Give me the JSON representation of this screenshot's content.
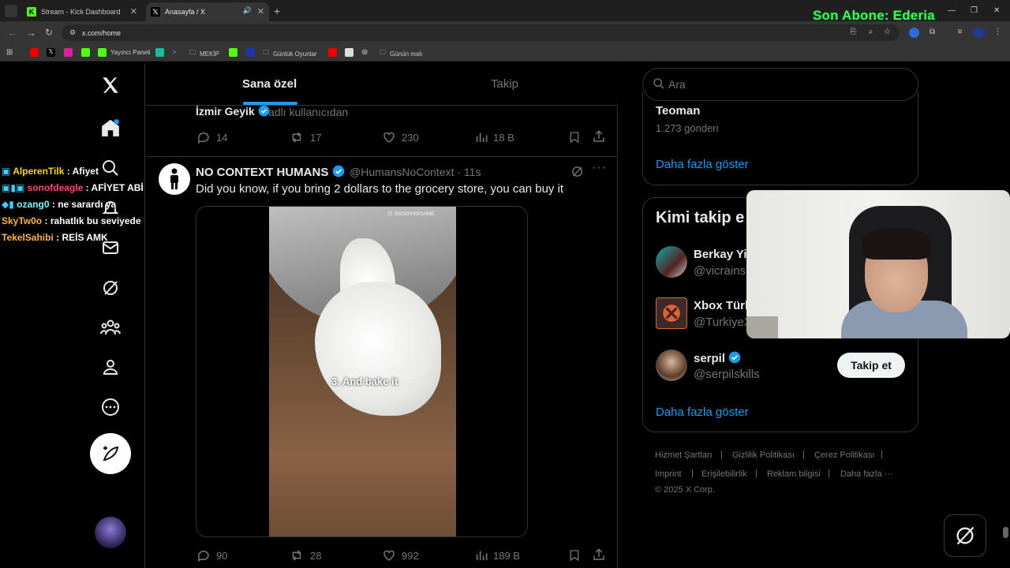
{
  "browser": {
    "tabs": [
      {
        "title": "Stream - Kick Dashboard",
        "favicon": "kick-icon"
      },
      {
        "title": "Anasayfa / X",
        "favicon": "x-icon"
      }
    ],
    "overlay_subscriber": "Son Abone: Ederia",
    "url": "x.com/home",
    "bookmarks": [
      "Yayıncı Paneli",
      "MEKİP",
      "Günlük Oyunlar",
      "Günün malı"
    ]
  },
  "chat": [
    {
      "user": "AlperenTilk",
      "message": "Afiyet",
      "color": "#ffd700"
    },
    {
      "user": "sonofdeagle",
      "message": "AFİYET ABİ",
      "color": "#ff4d6d"
    },
    {
      "user": "ozang0",
      "message": "ne sarardı ya",
      "color": "#7cf7ff"
    },
    {
      "user": "SkyTw0o",
      "message": "rahatlık bu seviyede",
      "color": "#ffb347"
    },
    {
      "user": "TekelSahibi",
      "message": "REİS AMK",
      "color": "#ffb347"
    }
  ],
  "feed": {
    "tabs": [
      "Sana özel",
      "Takip"
    ],
    "active_tab": "Sana özel",
    "previous_post": {
      "user": "İzmir Geyik",
      "suffix": "adlı kullanıcıdan",
      "replies": "14",
      "reposts": "17",
      "likes": "230",
      "views": "18 B"
    },
    "tweet": {
      "name": "NO CONTEXT HUMANS",
      "handle": "@HumansNoContext · 11s",
      "text": "Did you know, if you bring 2 dollars to the grocery store, you can buy it",
      "video_caption": "3. And bake it",
      "video_watermark": "itsconnorcreat",
      "replies": "90",
      "reposts": "28",
      "likes": "992",
      "views": "189 B"
    }
  },
  "sidebar": {
    "search_placeholder": "Ara",
    "trend": {
      "title": "Teoman",
      "count": "1.273 gönderi"
    },
    "show_more": "Daha fazla göster",
    "who_to_follow_title": "Kimi takip e",
    "who_to_follow": [
      {
        "name": "Berkay Yi",
        "handle": "@vicrains"
      },
      {
        "name": "Xbox Türk",
        "handle": "@TurkiyeX"
      },
      {
        "name": "serpil",
        "handle": "@serpilskills"
      }
    ],
    "follow_label": "Takip et",
    "show_more_2": "Daha fazla göster",
    "footer": [
      "Hizmet Şartları",
      "Gizlilik Politikası",
      "Çerez Politikası",
      "Imprint",
      "Erişilebilirlik",
      "Reklam bilgisi",
      "Daha fazla ···",
      "© 2025 X Corp."
    ]
  }
}
